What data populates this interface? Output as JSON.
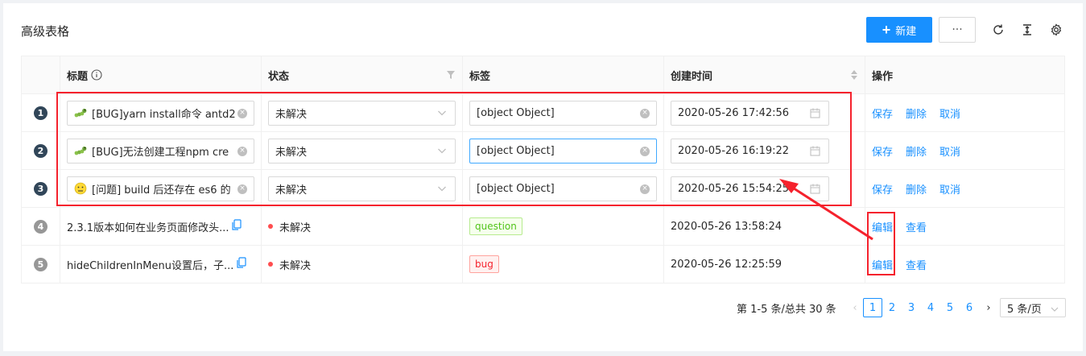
{
  "page": {
    "title": "高级表格"
  },
  "toolbar": {
    "new_label": "新建",
    "more_label": "···"
  },
  "columns": [
    "标题",
    "状态",
    "标签",
    "创建时间",
    "操作"
  ],
  "edit_rows": [
    {
      "index": "1",
      "title": "[BUG]yarn install命令 antd2",
      "status": "未解决",
      "label": "[object Object]",
      "time": "2020-05-26 17:42:56",
      "actions": [
        "保存",
        "删除",
        "取消"
      ]
    },
    {
      "index": "2",
      "title": "[BUG]无法创建工程npm cre",
      "status": "未解决",
      "label": "[object Object]",
      "time": "2020-05-26 16:19:22",
      "actions": [
        "保存",
        "删除",
        "取消"
      ]
    },
    {
      "index": "3",
      "title": "[问题] build 后还存在 es6 的",
      "status": "未解决",
      "label": "[object Object]",
      "time": "2020-05-26 15:54:25",
      "actions": [
        "保存",
        "删除",
        "取消"
      ]
    }
  ],
  "view_rows": [
    {
      "index": "4",
      "title": "2.3.1版本如何在业务页面修改头...",
      "status": "未解决",
      "tag": "question",
      "time": "2020-05-26 13:58:24",
      "actions": [
        "编辑",
        "查看"
      ]
    },
    {
      "index": "5",
      "title": "hideChildrenInMenu设置后，子...",
      "status": "未解决",
      "tag": "bug",
      "time": "2020-05-26 12:25:59",
      "actions": [
        "编辑",
        "查看"
      ]
    }
  ],
  "pagination": {
    "total_text": "第 1-5 条/总共 30 条",
    "pages": [
      "1",
      "2",
      "3",
      "4",
      "5",
      "6"
    ],
    "current": "1",
    "page_size": "5 条/页"
  },
  "colors": {
    "primary": "#1890ff",
    "danger": "#f5222d",
    "annotation": "#f5222d"
  }
}
